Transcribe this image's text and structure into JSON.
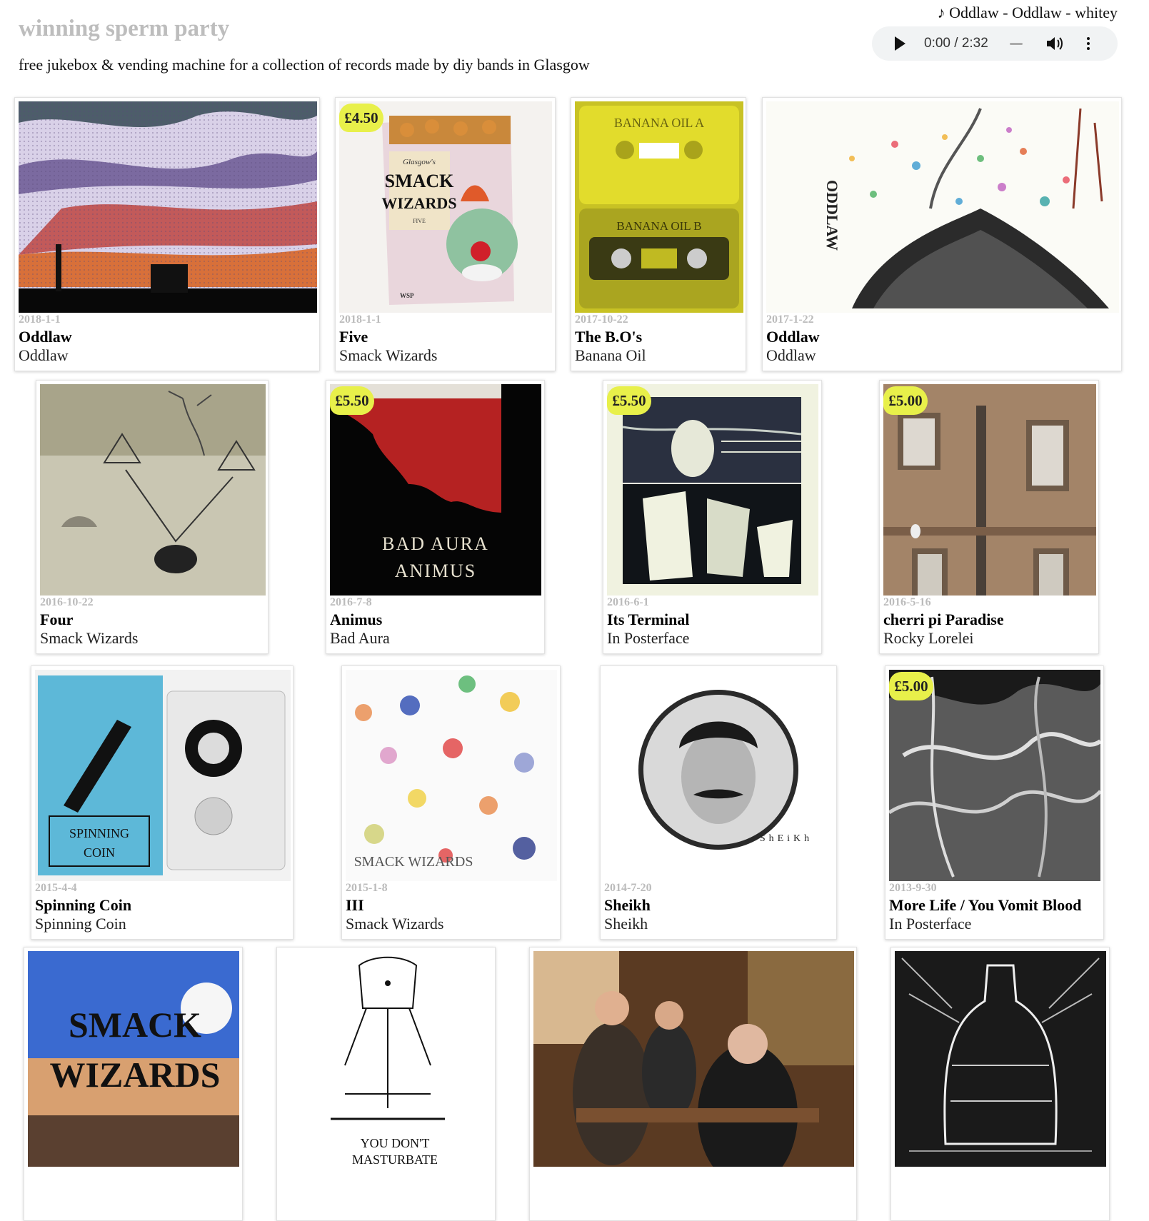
{
  "header": {
    "site_title": "winning sperm party",
    "tagline": "free jukebox & vending machine for a collection of records made by diy bands in Glasgow"
  },
  "player": {
    "now_playing": "♪ Oddlaw - Oddlaw - whitey",
    "time": "0:00 / 2:32",
    "icons": [
      "play-icon",
      "volume-icon",
      "more-options-icon"
    ]
  },
  "accent_colors": {
    "price_tag": "#e8f04a",
    "date": "#bbbbbb",
    "title_color": "#bdbdbd"
  },
  "releases": [
    {
      "date": "2018-1-1",
      "title": "Oddlaw",
      "artist": "Oddlaw",
      "price": ""
    },
    {
      "date": "2018-1-1",
      "title": "Five",
      "artist": "Smack Wizards",
      "price": "£4.50"
    },
    {
      "date": "2017-10-22",
      "title": "The B.O's",
      "artist": "Banana Oil",
      "price": ""
    },
    {
      "date": "2017-1-22",
      "title": "Oddlaw",
      "artist": "Oddlaw",
      "price": ""
    },
    {
      "date": "2016-10-22",
      "title": "Four",
      "artist": "Smack Wizards",
      "price": ""
    },
    {
      "date": "2016-7-8",
      "title": "Animus",
      "artist": "Bad Aura",
      "price": "£5.50"
    },
    {
      "date": "2016-6-1",
      "title": "Its Terminal",
      "artist": "In Posterface",
      "price": "£5.50"
    },
    {
      "date": "2016-5-16",
      "title": "cherri pi Paradise",
      "artist": "Rocky Lorelei",
      "price": "£5.00"
    },
    {
      "date": "2015-4-4",
      "title": "Spinning Coin",
      "artist": "Spinning Coin",
      "price": ""
    },
    {
      "date": "2015-1-8",
      "title": "III",
      "artist": "Smack Wizards",
      "price": ""
    },
    {
      "date": "2014-7-20",
      "title": "Sheikh",
      "artist": "Sheikh",
      "price": ""
    },
    {
      "date": "2013-9-30",
      "title": "More Life / You Vomit Blood",
      "artist": "In Posterface",
      "price": "£5.00"
    },
    {
      "date": "",
      "title": "",
      "artist": "",
      "price": ""
    },
    {
      "date": "",
      "title": "",
      "artist": "",
      "price": ""
    },
    {
      "date": "",
      "title": "",
      "artist": "",
      "price": ""
    },
    {
      "date": "",
      "title": "",
      "artist": "",
      "price": ""
    }
  ],
  "cover_art_text": {
    "five": [
      "Glasgow's",
      "SMACK",
      "WIZARDS",
      "FIVE",
      "WSP"
    ],
    "bos": [
      "BANANA OIL A",
      "BANANA OIL B"
    ],
    "oddlaw2": [
      "ODDLAW"
    ],
    "animus": [
      "BAD AURA",
      "ANIMUS"
    ],
    "spinning": [
      "SPINNING",
      "COIN"
    ],
    "iii": [
      "SMACK WIZARDS"
    ],
    "sheikh": [
      "ShEiKh"
    ],
    "sw_old": [
      "SMACK",
      "WIZARDS"
    ],
    "sketch": [
      "YOU DON'T",
      "MASTURBATE"
    ]
  }
}
